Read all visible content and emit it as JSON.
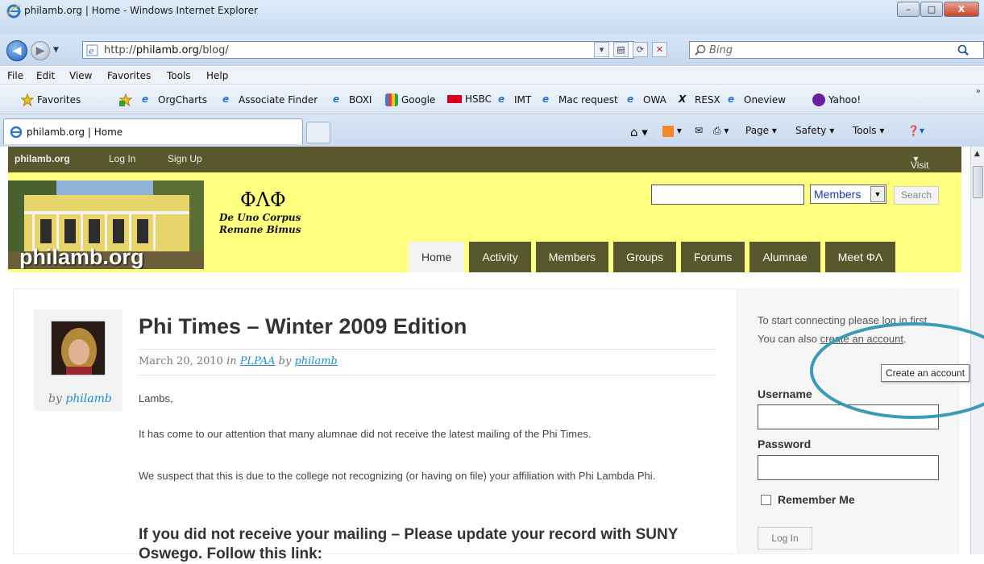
{
  "window": {
    "title": "philamb.org | Home - Windows Internet Explorer"
  },
  "address": {
    "url_prefix": "http://",
    "url_domain": "philamb.org",
    "url_path": "/blog/"
  },
  "search": {
    "placeholder": "Bing"
  },
  "menu": [
    "File",
    "Edit",
    "View",
    "Favorites",
    "Tools",
    "Help"
  ],
  "favorites": {
    "label": "Favorites",
    "items": [
      "OrgCharts",
      "Associate Finder",
      "BOXI",
      "Google",
      "HSBC",
      "IMT",
      "Mac request",
      "OWA",
      "RESX",
      "Oneview",
      "Yahoo!"
    ]
  },
  "tab": {
    "label": "philamb.org | Home"
  },
  "commandbar": {
    "page": "Page",
    "safety": "Safety",
    "tools": "Tools"
  },
  "adminbar": {
    "site": "philamb.org",
    "login": "Log In",
    "signup": "Sign Up",
    "visit": "Visit"
  },
  "header": {
    "site_name": "philamb.org",
    "greek": "ΦΛΦ",
    "motto_line1": "De Uno Corpus",
    "motto_line2": "Remane Bimus",
    "search_value": "",
    "select_value": "Members",
    "search_button": "Search"
  },
  "nav": [
    "Home",
    "Activity",
    "Members",
    "Groups",
    "Forums",
    "Alumnae",
    "Meet ΦΛ"
  ],
  "post": {
    "author_by": "by",
    "author": "philamb",
    "title": "Phi Times – Winter 2009 Edition",
    "date": "March 20, 2010",
    "in": "in",
    "category": "PLPAA",
    "by": "by",
    "greeting": "Lambs,",
    "p1": "It has come to our attention that many alumnae did not receive the latest mailing of the Phi Times.",
    "p2": "We suspect that this is due to the college not recognizing (or having on file) your affiliation with Phi Lambda Phi.",
    "subhead": "If you did not receive your mailing – Please update your record with SUNY Oswego. Follow this link:"
  },
  "sidebar": {
    "intro": "To start connecting please log in first. You can also",
    "create_link": "create an account",
    "period": ".",
    "username_label": "Username",
    "password_label": "Password",
    "remember_label": "Remember Me",
    "login_button": "Log In",
    "tooltip": "Create an account"
  },
  "colors": {
    "olive": "#58582c",
    "header_yellow": "#ffff7f",
    "annotation": "#3a9ab8",
    "link": "#1f8fd1"
  }
}
